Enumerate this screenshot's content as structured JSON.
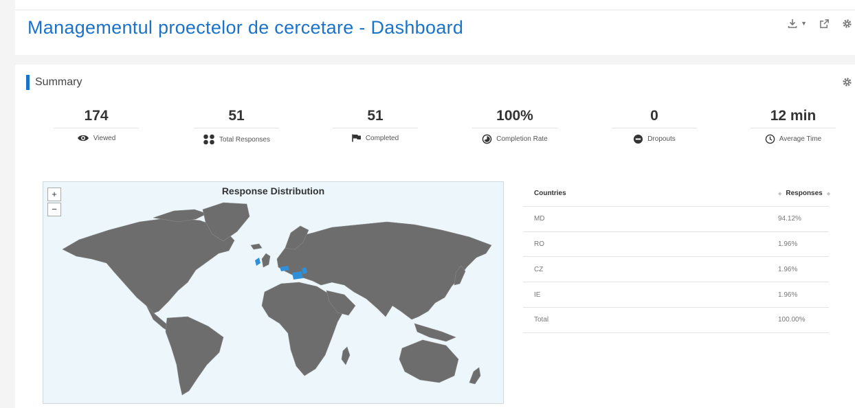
{
  "page": {
    "title": "Managementul proectelor de cercetare - Dashboard"
  },
  "header": {
    "icons": [
      "download-icon",
      "chevron-down-icon",
      "share-icon",
      "gear-icon"
    ],
    "accent_color": "#1a73c9"
  },
  "summary": {
    "title": "Summary",
    "stats": [
      {
        "value": "174",
        "label": "Viewed",
        "icon": "eye-icon"
      },
      {
        "value": "51",
        "label": "Total Responses",
        "icon": "dots-grid-icon"
      },
      {
        "value": "51",
        "label": "Completed",
        "icon": "flag-icon"
      },
      {
        "value": "100%",
        "label": "Completion Rate",
        "icon": "pie-icon"
      },
      {
        "value": "0",
        "label": "Dropouts",
        "icon": "minus-circle-icon"
      },
      {
        "value": "12 min",
        "label": "Average Time",
        "icon": "clock-icon"
      }
    ]
  },
  "map": {
    "title": "Response Distribution",
    "zoom_in": "+",
    "zoom_out": "−",
    "land_color": "#6d6d6d",
    "water_color": "#ecf6fb",
    "highlight_color": "#2f8fd8"
  },
  "table": {
    "headers": [
      "Countries",
      "Responses"
    ],
    "rows": [
      {
        "country": "MD",
        "responses": "94.12%"
      },
      {
        "country": "RO",
        "responses": "1.96%"
      },
      {
        "country": "CZ",
        "responses": "1.96%"
      },
      {
        "country": "IE",
        "responses": "1.96%"
      },
      {
        "country": "Total",
        "responses": "100.00%"
      }
    ]
  }
}
